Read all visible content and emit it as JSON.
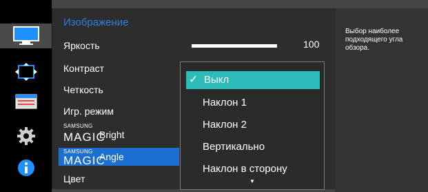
{
  "menu": {
    "title": "Изображение",
    "items": [
      {
        "label": "Яркость"
      },
      {
        "label": "Контраст"
      },
      {
        "label": "Четкость"
      },
      {
        "label": "Игр. режим"
      },
      {
        "brand_top": "SAMSUNG",
        "brand_bottom": "MAGIC",
        "label": "Bright"
      },
      {
        "brand_top": "SAMSUNG",
        "brand_bottom": "MAGIC",
        "label": "Angle"
      },
      {
        "label": "Цвет"
      }
    ],
    "selected_index": 5
  },
  "brightness": {
    "value": "100",
    "level_percent": 100
  },
  "dropdown": {
    "options": [
      "Выкл",
      "Наклон 1",
      "Наклон 2",
      "Вертикально",
      "Наклон в сторону"
    ],
    "selected_index": 0,
    "check_glyph": "✓",
    "more_arrow": "▼"
  },
  "help": {
    "text": "Выбор наиболее подходящего угла обзора."
  },
  "sidebar": {
    "icons": [
      "picture-icon",
      "size-position-icon",
      "settings-sliders-icon",
      "gear-icon",
      "info-icon"
    ],
    "active_index": 0
  },
  "colors": {
    "accent_blue": "#1c6fcf",
    "title_blue": "#2f7fe0",
    "selected_option": "#2bbbb8"
  }
}
